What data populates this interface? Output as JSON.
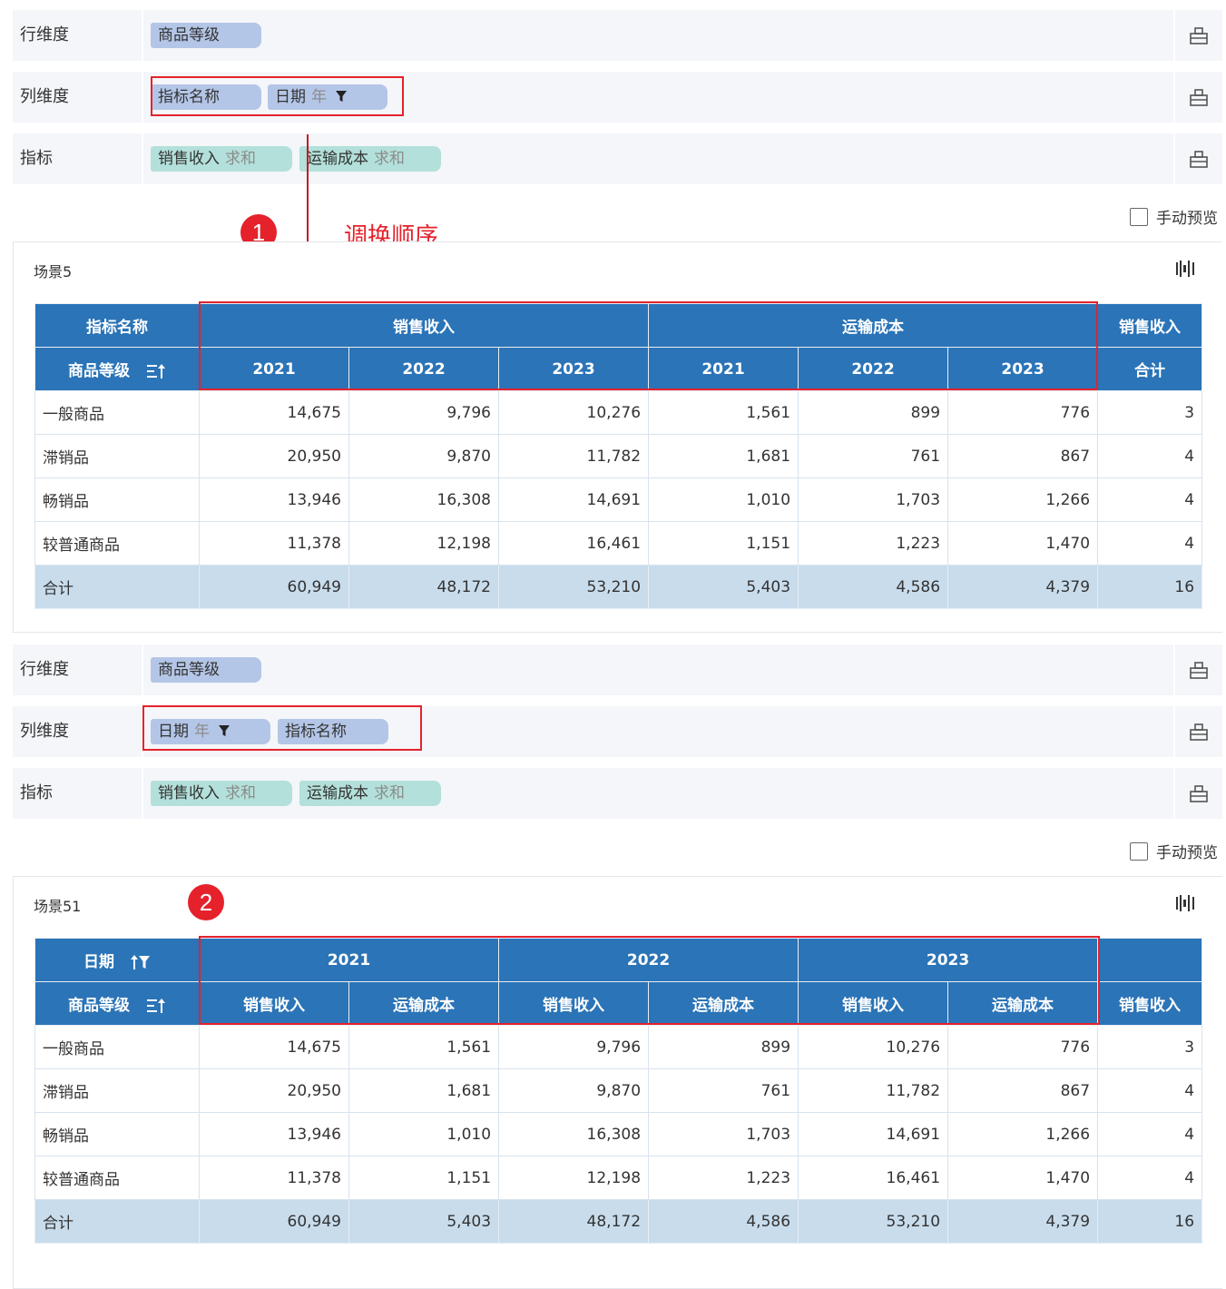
{
  "section1": {
    "row_dim": {
      "label": "行维度",
      "chips": [
        "商品等级"
      ]
    },
    "col_dim": {
      "label": "列维度",
      "chips": [
        {
          "name": "指标名称"
        },
        {
          "name": "日期",
          "agg": "年"
        }
      ]
    },
    "measures": {
      "label": "指标",
      "chips": [
        {
          "name": "销售收入",
          "agg": "求和"
        },
        {
          "name": "运输成本",
          "agg": "求和"
        }
      ]
    },
    "preview_label": "手动预览",
    "panel_title": "场景5",
    "table": {
      "corner_top": "指标名称",
      "corner_bottom": "商品等级",
      "top_groups": [
        "销售收入",
        "运输成本",
        "销售收入"
      ],
      "sub_headers": [
        "2021",
        "2022",
        "2023",
        "2021",
        "2022",
        "2023",
        "合计"
      ],
      "rows": [
        {
          "name": "一般商品",
          "values": [
            "14,675",
            "9,796",
            "10,276",
            "1,561",
            "899",
            "776",
            "3"
          ]
        },
        {
          "name": "滞销品",
          "values": [
            "20,950",
            "9,870",
            "11,782",
            "1,681",
            "761",
            "867",
            "4"
          ]
        },
        {
          "name": "畅销品",
          "values": [
            "13,946",
            "16,308",
            "14,691",
            "1,010",
            "1,703",
            "1,266",
            "4"
          ]
        },
        {
          "name": "较普通商品",
          "values": [
            "11,378",
            "12,198",
            "16,461",
            "1,151",
            "1,223",
            "1,470",
            "4"
          ]
        }
      ],
      "total": {
        "name": "合计",
        "values": [
          "60,949",
          "48,172",
          "53,210",
          "5,403",
          "4,586",
          "4,379",
          "16"
        ]
      }
    }
  },
  "section2": {
    "row_dim": {
      "label": "行维度",
      "chips": [
        "商品等级"
      ]
    },
    "col_dim": {
      "label": "列维度",
      "chips": [
        {
          "name": "日期",
          "agg": "年"
        },
        {
          "name": "指标名称"
        }
      ]
    },
    "measures": {
      "label": "指标",
      "chips": [
        {
          "name": "销售收入",
          "agg": "求和"
        },
        {
          "name": "运输成本",
          "agg": "求和"
        }
      ]
    },
    "preview_label": "手动预览",
    "panel_title": "场景51",
    "table": {
      "corner_top": "日期",
      "corner_bottom": "商品等级",
      "top_groups": [
        "2021",
        "2022",
        "2023",
        ""
      ],
      "sub_headers": [
        "销售收入",
        "运输成本",
        "销售收入",
        "运输成本",
        "销售收入",
        "运输成本",
        "销售收入"
      ],
      "rows": [
        {
          "name": "一般商品",
          "values": [
            "14,675",
            "1,561",
            "9,796",
            "899",
            "10,276",
            "776",
            "3"
          ]
        },
        {
          "name": "滞销品",
          "values": [
            "20,950",
            "1,681",
            "9,870",
            "761",
            "11,782",
            "867",
            "4"
          ]
        },
        {
          "name": "畅销品",
          "values": [
            "13,946",
            "1,010",
            "16,308",
            "1,703",
            "14,691",
            "1,266",
            "4"
          ]
        },
        {
          "name": "较普通商品",
          "values": [
            "11,378",
            "1,151",
            "12,198",
            "1,223",
            "16,461",
            "1,470",
            "4"
          ]
        }
      ],
      "total": {
        "name": "合计",
        "values": [
          "60,949",
          "5,403",
          "48,172",
          "4,586",
          "53,210",
          "4,379",
          "16"
        ]
      }
    }
  },
  "annotations": {
    "badge1": "1",
    "badge2": "2",
    "swap_label": "调换顺序"
  },
  "colors": {
    "header_blue": "#2b74b7",
    "total_row": "#c8dcec",
    "chip_blue": "#b4c6e7",
    "chip_green": "#b3e0da",
    "highlight_red": "#e5222c"
  },
  "icons": [
    "hierarchy-icon",
    "funnel-icon",
    "sort-icon",
    "filter-sort-icon",
    "chart-settings-icon"
  ]
}
